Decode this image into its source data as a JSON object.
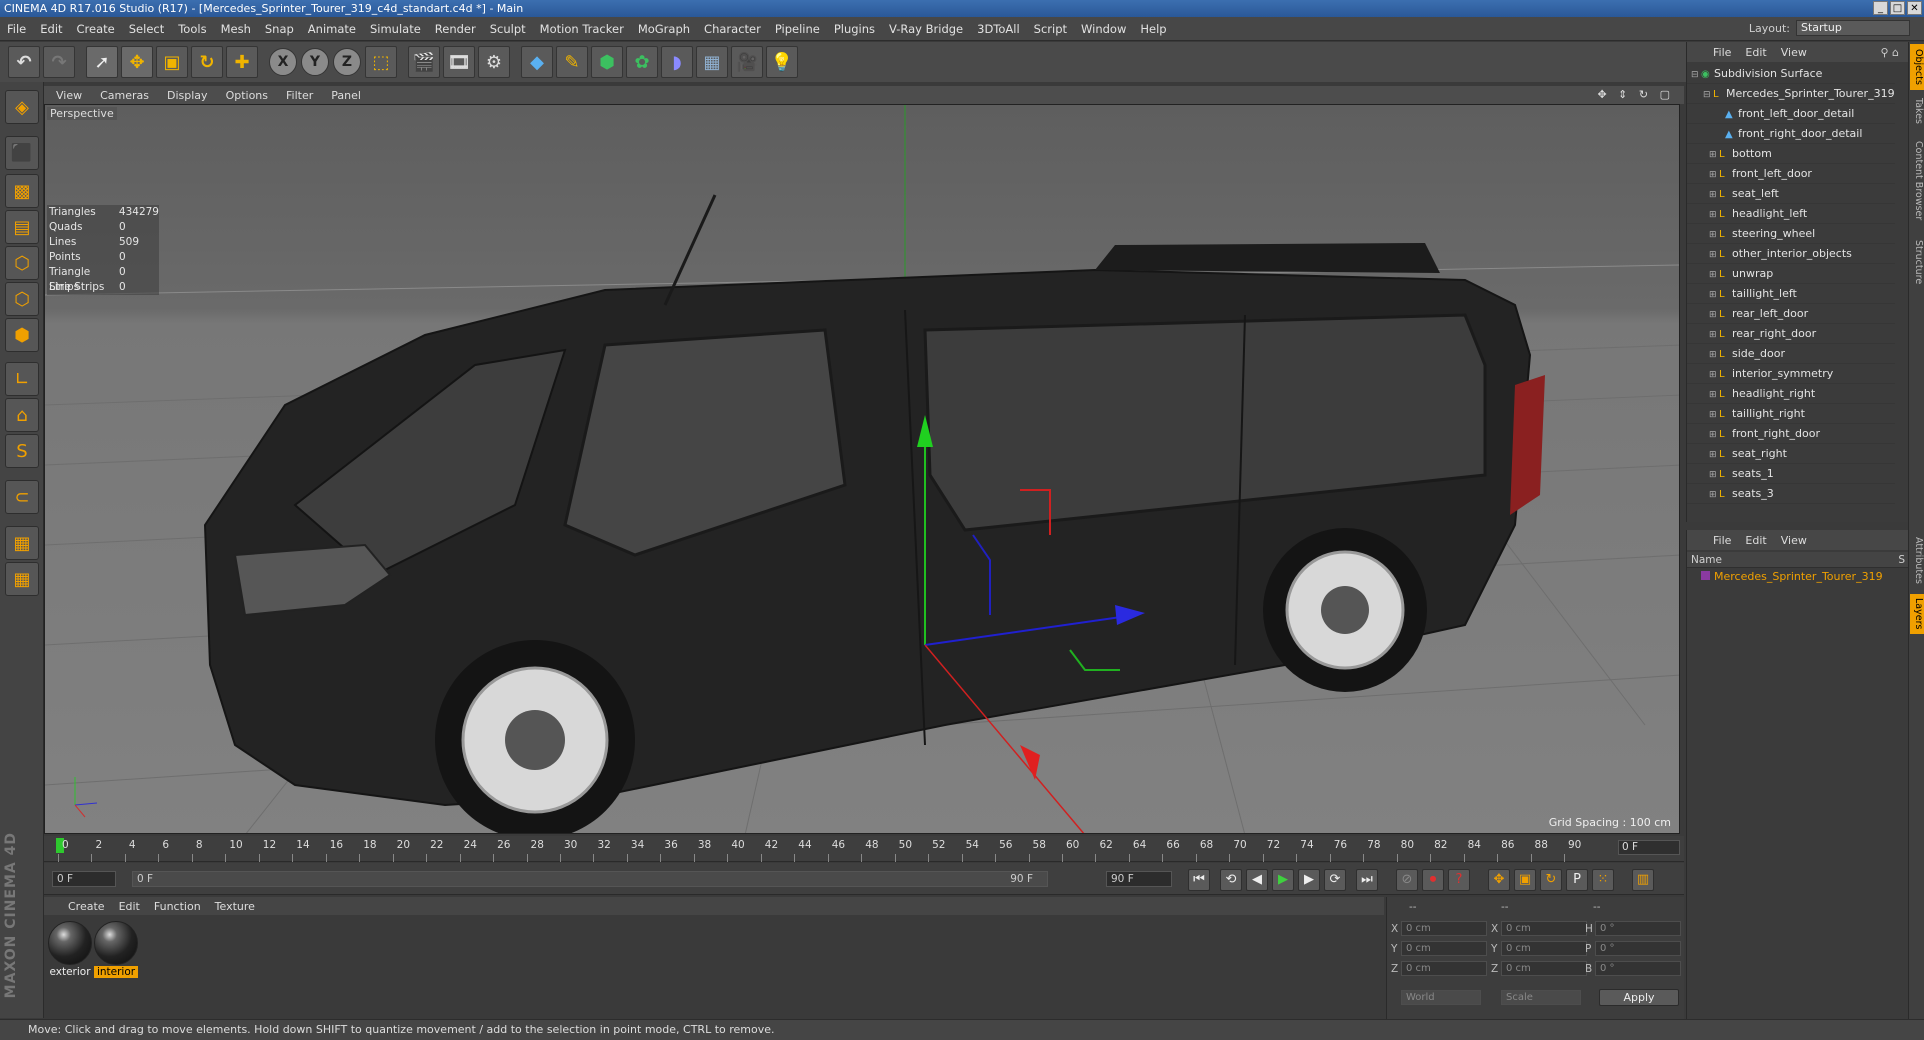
{
  "window": {
    "title": "CINEMA 4D R17.016 Studio (R17) - [Mercedes_Sprinter_Tourer_319_c4d_standart.c4d *] - Main"
  },
  "menu": [
    "File",
    "Edit",
    "Create",
    "Select",
    "Tools",
    "Mesh",
    "Snap",
    "Animate",
    "Simulate",
    "Render",
    "Sculpt",
    "Motion Tracker",
    "MoGraph",
    "Character",
    "Pipeline",
    "Plugins",
    "V-Ray Bridge",
    "3DToAll",
    "Script",
    "Window",
    "Help"
  ],
  "layout": {
    "label": "Layout:",
    "value": "Startup"
  },
  "viewport": {
    "menu": [
      "View",
      "Cameras",
      "Display",
      "Options",
      "Filter",
      "Panel"
    ],
    "label": "Perspective",
    "grid_spacing": "Grid Spacing : 100 cm",
    "stats": [
      {
        "k": "Triangles",
        "v": "434279"
      },
      {
        "k": "Quads",
        "v": "0"
      },
      {
        "k": "Lines",
        "v": "509"
      },
      {
        "k": "Points",
        "v": "0"
      },
      {
        "k": "Triangle Strips",
        "v": "0"
      },
      {
        "k": "Line Strips",
        "v": "0"
      }
    ]
  },
  "timeline": {
    "ticks": [
      "0",
      "2",
      "4",
      "6",
      "8",
      "10",
      "12",
      "14",
      "16",
      "18",
      "20",
      "22",
      "24",
      "26",
      "28",
      "30",
      "32",
      "34",
      "36",
      "38",
      "40",
      "42",
      "44",
      "46",
      "48",
      "50",
      "52",
      "54",
      "56",
      "58",
      "60",
      "62",
      "64",
      "66",
      "68",
      "70",
      "72",
      "74",
      "76",
      "78",
      "80",
      "82",
      "84",
      "86",
      "88",
      "90"
    ],
    "current": "0 F"
  },
  "transport": {
    "start": "0 F",
    "range_start": "0 F",
    "range_end": "90 F",
    "end": "90 F"
  },
  "materials": {
    "menu": [
      "Create",
      "Edit",
      "Function",
      "Texture"
    ],
    "items": [
      {
        "name": "exterior"
      },
      {
        "name": "interior"
      }
    ]
  },
  "attributes": {
    "hdr": [
      "--",
      "--",
      "--"
    ],
    "rows": [
      {
        "a": "X",
        "av": "0 cm",
        "b": "X",
        "bv": "0 cm",
        "c": "H",
        "cv": "0 °"
      },
      {
        "a": "Y",
        "av": "0 cm",
        "b": "Y",
        "bv": "0 cm",
        "c": "P",
        "cv": "0 °"
      },
      {
        "a": "Z",
        "av": "0 cm",
        "b": "Z",
        "bv": "0 cm",
        "c": "B",
        "cv": "0 °"
      }
    ],
    "world": "World",
    "scale": "Scale",
    "apply": "Apply"
  },
  "objects": {
    "menu": [
      "File",
      "Edit",
      "View"
    ],
    "items": [
      "Subdivision Surface",
      "Mercedes_Sprinter_Tourer_319",
      "front_left_door_detail",
      "front_right_door_detail",
      "bottom",
      "front_left_door",
      "seat_left",
      "headlight_left",
      "steering_wheel",
      "other_interior_objects",
      "unwrap",
      "taillight_left",
      "rear_left_door",
      "rear_right_door",
      "side_door",
      "interior_symmetry",
      "headlight_right",
      "taillight_right",
      "front_right_door",
      "seat_right",
      "seats_1",
      "seats_3"
    ]
  },
  "layers": {
    "menu": [
      "File",
      "Edit",
      "View"
    ],
    "col_name": "Name",
    "col_s": "S",
    "items": [
      "Mercedes_Sprinter_Tourer_319"
    ]
  },
  "side_tabs": [
    "Objects",
    "Takes",
    "Content Browser",
    "Structure",
    "Attributes",
    "Layers"
  ],
  "brand": "MAXON CINEMA 4D",
  "status": "Move: Click and drag to move elements. Hold down SHIFT to quantize movement / add to the selection in point mode, CTRL to remove.",
  "colors": {
    "accent": "#f0a000",
    "menubar": "#474747",
    "viewport": "#777777"
  }
}
